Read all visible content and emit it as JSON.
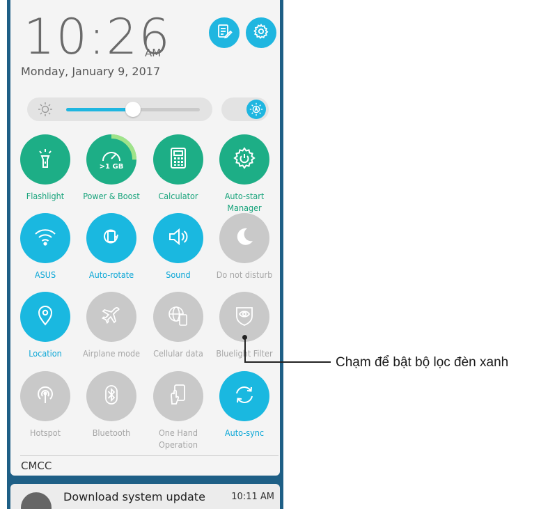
{
  "clock": {
    "time": "10:26",
    "ampm": "AM",
    "date": "Monday, January 9, 2017"
  },
  "header_buttons": {
    "left_icon": "notes-edit-icon",
    "right_icon": "gear-icon"
  },
  "brightness": {
    "level": 0.5,
    "auto_icon": "auto-brightness-icon"
  },
  "tiles": [
    {
      "label": "Flashlight",
      "icon": "flashlight-icon",
      "state": "on",
      "color": "#1dae86"
    },
    {
      "label": "Power & Boost",
      "icon": "speedometer-icon",
      "state": "on",
      "badge": ">1 GB",
      "color": "#1dae86"
    },
    {
      "label": "Calculator",
      "icon": "calculator-icon",
      "state": "on",
      "color": "#1dae86"
    },
    {
      "label": "Auto-start",
      "label2": "Manager",
      "icon": "gear-power-icon",
      "state": "on",
      "color": "#1dae86"
    },
    {
      "label": "ASUS",
      "icon": "wifi-icon",
      "state": "on",
      "color": "#1ab8e0"
    },
    {
      "label": "Auto-rotate",
      "icon": "rotate-icon",
      "state": "on",
      "color": "#1ab8e0"
    },
    {
      "label": "Sound",
      "icon": "speaker-icon",
      "state": "on",
      "color": "#1ab8e0"
    },
    {
      "label": "Do not disturb",
      "icon": "moon-icon",
      "state": "off",
      "color": "#c9c9c9"
    },
    {
      "label": "Location",
      "icon": "location-pin-icon",
      "state": "on",
      "color": "#1ab8e0"
    },
    {
      "label": "Airplane mode",
      "icon": "airplane-icon",
      "state": "off",
      "color": "#c9c9c9"
    },
    {
      "label": "Cellular data",
      "icon": "globe-phone-icon",
      "state": "off",
      "color": "#c9c9c9"
    },
    {
      "label": "Bluelight Filter",
      "icon": "eye-shield-icon",
      "state": "off",
      "color": "#c9c9c9"
    },
    {
      "label": "Hotspot",
      "icon": "hotspot-icon",
      "state": "off",
      "color": "#c9c9c9"
    },
    {
      "label": "Bluetooth",
      "icon": "bluetooth-icon",
      "state": "off",
      "color": "#c9c9c9"
    },
    {
      "label": "One Hand",
      "label2": "Operation",
      "icon": "one-hand-phone-icon",
      "state": "off",
      "color": "#c9c9c9"
    },
    {
      "label": "Auto-sync",
      "icon": "sync-icon",
      "state": "on",
      "color": "#1ab8e0"
    }
  ],
  "carrier": "CMCC",
  "notification": {
    "title": "Download system update",
    "time": "10:11 AM"
  },
  "callout": {
    "text": "Chạm để bật bộ lọc đèn xanh"
  },
  "colors": {
    "accent_blue": "#1ab8e0",
    "accent_green": "#1dae86",
    "panel_bg": "#f4f4f4",
    "wallpaper": "#1e5f86"
  }
}
